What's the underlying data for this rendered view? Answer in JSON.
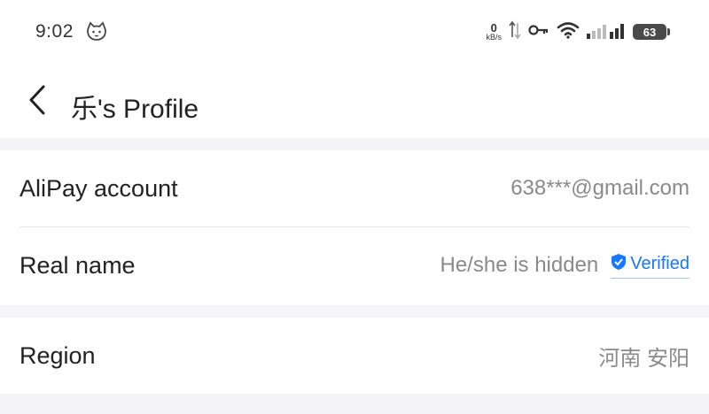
{
  "status_bar": {
    "time": "9:02",
    "net_speed_value": "0",
    "net_speed_unit": "kB/s",
    "battery_level": "63"
  },
  "header": {
    "back_icon": "chevron-left-icon",
    "title": "乐's Profile"
  },
  "account_section": {
    "alipay": {
      "label": "AliPay account",
      "value": "638***@gmail.com"
    },
    "real_name": {
      "label": "Real name",
      "value": "He/she is hidden",
      "badge": "Verified"
    }
  },
  "region_section": {
    "region": {
      "label": "Region",
      "value": "河南 安阳"
    }
  },
  "colors": {
    "accent": "#1677ff",
    "background": "#f4f4f8",
    "value_text": "#8a8a8a"
  }
}
